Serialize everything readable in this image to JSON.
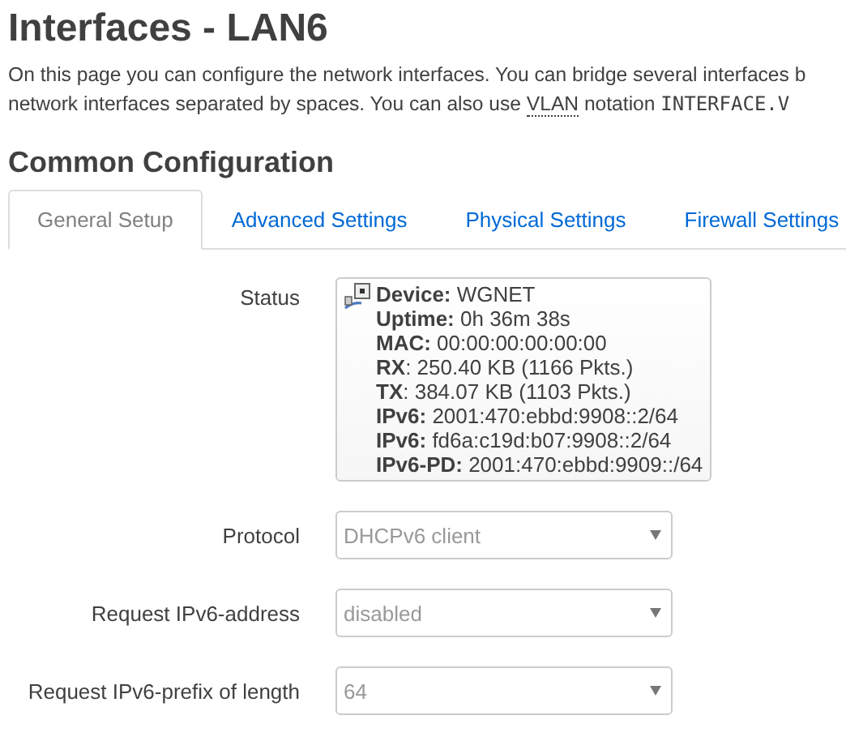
{
  "title": "Interfaces - LAN6",
  "description": [
    {
      "kind": "text",
      "text": "On this page you can configure the network interfaces. You can bridge several interfaces b"
    },
    {
      "kind": "break"
    },
    {
      "kind": "text",
      "text": "network interfaces separated by spaces. You can also use "
    },
    {
      "kind": "abbr",
      "text": "VLAN"
    },
    {
      "kind": "text",
      "text": " notation "
    },
    {
      "kind": "code",
      "text": "INTERFACE.V"
    }
  ],
  "section_title": "Common Configuration",
  "tabs": [
    {
      "label": "General Setup",
      "selected": true
    },
    {
      "label": "Advanced Settings",
      "selected": false
    },
    {
      "label": "Physical Settings",
      "selected": false
    },
    {
      "label": "Firewall Settings",
      "selected": false
    }
  ],
  "status": {
    "label": "Status",
    "lines": [
      "**Device:** WGNET",
      "**Uptime:** 0h 36m 38s",
      "**MAC:** 00:00:00:00:00:00",
      "**RX**: 250.40 KB (1166 Pkts.)",
      "**TX**: 384.07 KB (1103 Pkts.)",
      "**IPv6:** 2001:470:ebbd:9908::2/64",
      "**IPv6:** fd6a:c19d:b07:9908::2/64",
      "**IPv6-PD:** 2001:470:ebbd:9909::/64"
    ]
  },
  "fields": [
    {
      "label": "Protocol",
      "value": "DHCPv6 client",
      "disabled": true
    },
    {
      "label": "Request IPv6-address",
      "value": "disabled",
      "disabled": true
    },
    {
      "label": "Request IPv6-prefix of length",
      "value": "64",
      "disabled": true
    }
  ]
}
